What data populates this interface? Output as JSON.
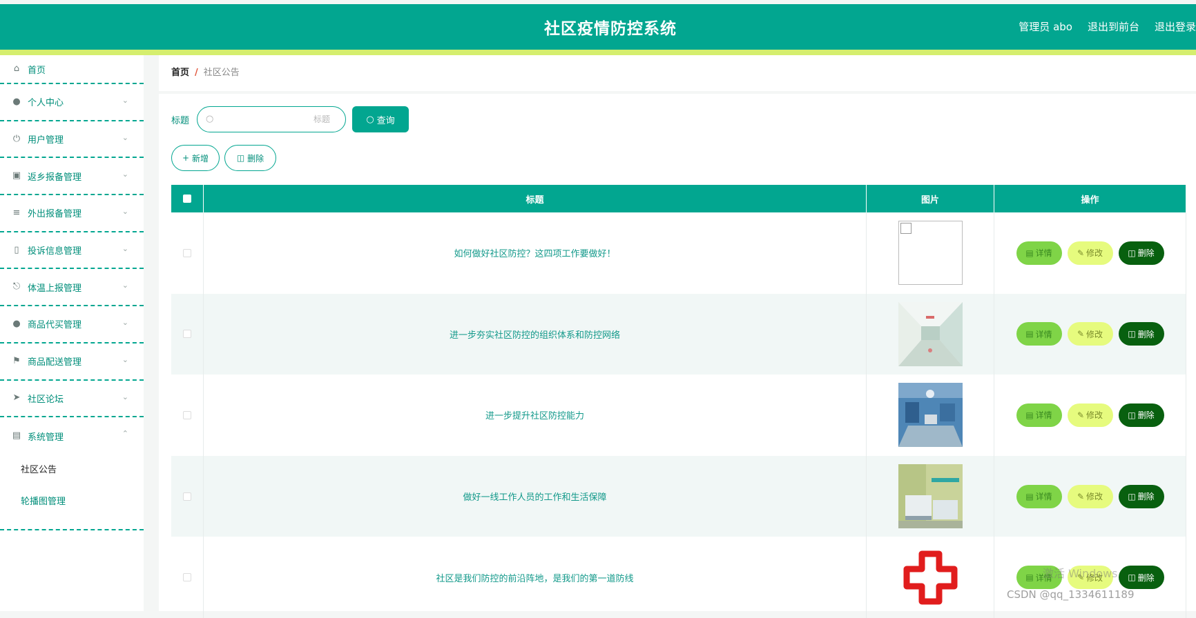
{
  "header": {
    "title": "社区疫情防控系统",
    "admin": "管理员 abo",
    "to_front": "退出到前台",
    "logout": "退出登录"
  },
  "sidebar": {
    "items": [
      {
        "label": "首页",
        "icon": "home-icon"
      },
      {
        "label": "个人中心",
        "icon": "user-icon"
      },
      {
        "label": "用户管理",
        "icon": "power-icon"
      },
      {
        "label": "返乡报备管理",
        "icon": "chat-icon"
      },
      {
        "label": "外出报备管理",
        "icon": "list-icon"
      },
      {
        "label": "投诉信息管理",
        "icon": "phone-icon"
      },
      {
        "label": "体温上报管理",
        "icon": "mic-icon"
      },
      {
        "label": "商品代买管理",
        "icon": "user-icon"
      },
      {
        "label": "商品配送管理",
        "icon": "flag-icon"
      },
      {
        "label": "社区论坛",
        "icon": "send-icon"
      },
      {
        "label": "系统管理",
        "icon": "chart-icon"
      }
    ],
    "submenu": [
      "社区公告",
      "轮播图管理"
    ]
  },
  "breadcrumb": {
    "home": "首页",
    "separator": "/",
    "current": "社区公告"
  },
  "search": {
    "label": "标题",
    "placeholder": "标题",
    "button": "查询"
  },
  "actions": {
    "add": "新增",
    "delete": "删除"
  },
  "table": {
    "headers": {
      "title": "标题",
      "image": "图片",
      "ops": "操作"
    },
    "rows": [
      {
        "title": "如何做好社区防控？这四项工作要做好！",
        "image": "broken"
      },
      {
        "title": "进一步夯实社区防控的组织体系和防控网络",
        "image": "corridor"
      },
      {
        "title": "进一步提升社区防控能力",
        "image": "operating-room"
      },
      {
        "title": "做好一线工作人员的工作和生活保障",
        "image": "ward"
      },
      {
        "title": "社区是我们防控的前沿阵地，是我们的第一道防线",
        "image": "red-cross"
      }
    ],
    "op_labels": {
      "detail": "详情",
      "edit": "修改",
      "delete": "删除"
    }
  },
  "watermark": {
    "line1": "激活 Windows",
    "line2": "CSDN @qq_1334611189"
  },
  "colors": {
    "primary": "#02a690",
    "stripe": "#d5ee6e",
    "detail": "#7fd447",
    "edit": "#e6fb7e",
    "delete": "#08600f"
  }
}
